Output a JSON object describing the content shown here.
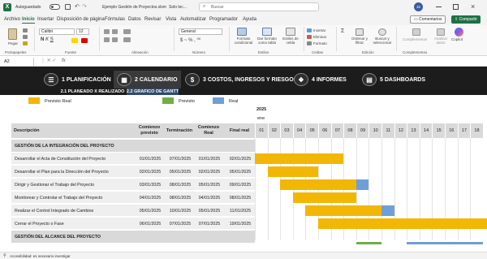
{
  "window": {
    "autosave_label": "Autoguardado",
    "file_title": "Ejemplo Gestión de Proyectos.xlsm",
    "save_state": "Solo lec...",
    "search_placeholder": "Buscar",
    "user_initials": "JS"
  },
  "menu": {
    "items": [
      "Archivo",
      "Inicio",
      "Insertar",
      "Disposición de página",
      "Fórmulas",
      "Datos",
      "Revisar",
      "Vista",
      "Automatizar",
      "Programador",
      "Ayuda"
    ],
    "active": "Inicio",
    "comments_label": "Comentarios",
    "share_label": "Compartir"
  },
  "ribbon": {
    "paste_label": "Pegar",
    "font_name": "Calibri",
    "font_size": "12",
    "number_format": "General",
    "conditional_format_label": "Formato condicional",
    "table_format_label": "Dar formato como tabla",
    "cell_styles_label": "Estilos de celda",
    "insert_label": "Insertar",
    "delete_label": "Eliminar",
    "format_label": "Formato",
    "sort_filter_label": "Ordenar y filtrar",
    "find_select_label": "Buscar y seleccionar",
    "addins_label": "Complementos",
    "analyze_label": "Analizar datos",
    "copilot_label": "Copilot",
    "groups": [
      "Portapapeles",
      "Fuente",
      "Alineación",
      "Número",
      "Estilos",
      "Celdas",
      "Edición",
      "Complementos"
    ]
  },
  "formula_bar": {
    "name_box": "A2",
    "fx": "fx"
  },
  "nav": {
    "tabs": [
      {
        "num": "1",
        "label": "PLANIFICACIÓN"
      },
      {
        "num": "2",
        "label": "CALENDARIO"
      },
      {
        "num": "3",
        "label": "COSTOS, INGRESOS Y RIESGOS"
      },
      {
        "num": "4",
        "label": "INFORMES"
      },
      {
        "num": "5",
        "label": "DASHBOARDS"
      }
    ],
    "subtabs": [
      "2.1 PLANEADO X REALIZADO",
      "2.2 GRAFICO DE GANTT"
    ]
  },
  "legend": {
    "planned_actual": "Previsto Real",
    "planned": "Previsto",
    "actual": "Real"
  },
  "colors": {
    "gold": "#f2b705",
    "green": "#70ad47",
    "blue": "#6f9fd8",
    "navbar": "#1c1c1c",
    "subtab_active": "#2f4a6d",
    "excel_green": "#1e7145"
  },
  "table": {
    "headers": {
      "description": "Descripción",
      "start": "Comienzo previsto",
      "end": "Terminación",
      "real_start": "Comienzo Real",
      "real_end": "Final real"
    },
    "year_label": "2025",
    "month_label": "ene",
    "days": [
      "01",
      "02",
      "03",
      "04",
      "05",
      "06",
      "07",
      "08",
      "09",
      "10",
      "11",
      "12",
      "13",
      "14",
      "15",
      "16",
      "17",
      "18"
    ],
    "rows": [
      {
        "type": "section",
        "desc": "GESTIÓN DE LA INTEGRACIÓN DEL PROYECTO"
      },
      {
        "type": "task",
        "desc": "Desarrollar el Acta de Constitución del Proyecto",
        "start": "01/01/2025",
        "end": "07/01/2025",
        "real_start": "01/01/2025",
        "real_end": "02/01/2025",
        "planned": [
          1,
          7
        ],
        "actual": [
          1,
          2
        ]
      },
      {
        "type": "task",
        "desc": "Desarrollar el Plan para la Dirección del Proyecto",
        "start": "02/01/2025",
        "end": "05/01/2025",
        "real_start": "02/01/2025",
        "real_end": "05/01/2025",
        "planned": [
          2,
          5
        ],
        "actual": [
          2,
          5
        ]
      },
      {
        "type": "task",
        "desc": "Dirigir y Gestionar el Trabajo del Proyecto",
        "start": "03/01/2025",
        "end": "08/01/2025",
        "real_start": "05/01/2025",
        "real_end": "09/01/2025",
        "planned": [
          3,
          8
        ],
        "actual": [
          5,
          9
        ]
      },
      {
        "type": "task",
        "desc": "Monitorear y Controlar el Trabajo del Proyecto",
        "start": "04/01/2025",
        "end": "08/01/2025",
        "real_start": "04/01/2025",
        "real_end": "08/01/2025",
        "planned": [
          4,
          8
        ],
        "actual": [
          4,
          8
        ]
      },
      {
        "type": "task",
        "desc": "Realizar el Control Integrado de Cambios",
        "start": "05/01/2025",
        "end": "10/01/2025",
        "real_start": "05/01/2025",
        "real_end": "11/01/2025",
        "planned": [
          5,
          10
        ],
        "actual": [
          5,
          11
        ]
      },
      {
        "type": "task",
        "desc": "Cerrar el Proyecto o Fase",
        "start": "06/01/2025",
        "end": "07/01/2025",
        "real_start": "07/01/2025",
        "real_end": "19/01/2025",
        "planned": [
          6,
          7
        ],
        "actual": [
          7,
          19
        ]
      },
      {
        "type": "section",
        "desc": "GESTIÓN DEL ALCANCE DEL PROYECTO"
      }
    ]
  },
  "status": {
    "accessibility": "Accesibilidad: es necesario investigar"
  }
}
